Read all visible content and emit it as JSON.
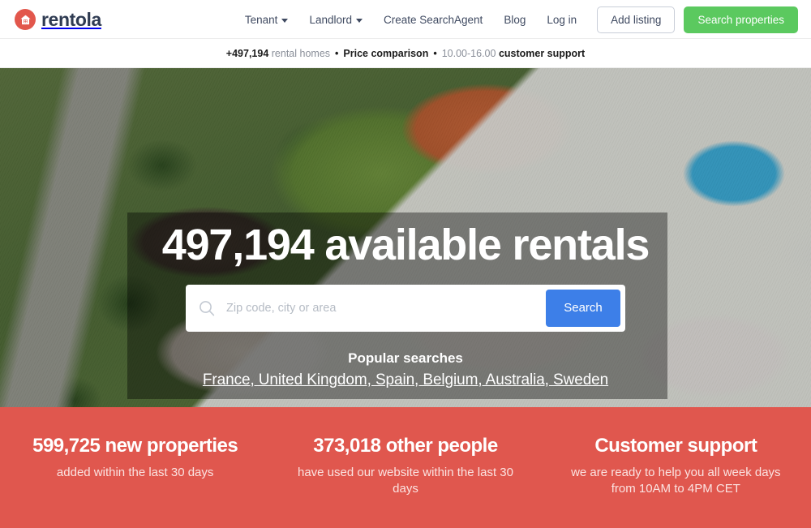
{
  "brand": {
    "name": "rentola",
    "logo_icon": "house-in-circle-icon",
    "color": "#e2574c"
  },
  "header": {
    "nav": [
      {
        "label": "Tenant",
        "has_caret": true,
        "name": "tenant"
      },
      {
        "label": "Landlord",
        "has_caret": true,
        "name": "landlord"
      },
      {
        "label": "Create SearchAgent",
        "has_caret": false,
        "name": "create-searchagent"
      },
      {
        "label": "Blog",
        "has_caret": false,
        "name": "blog"
      },
      {
        "label": "Log in",
        "has_caret": false,
        "name": "log-in"
      }
    ],
    "add_listing_label": "Add listing",
    "search_properties_label": "Search properties",
    "green_color": "#5bc95f"
  },
  "subheader": {
    "count": "+497,194",
    "count_suffix": "rental homes",
    "bullet": "•",
    "price_comparison": "Price comparison",
    "hours": "10.00-16.00",
    "support": "customer support"
  },
  "hero": {
    "title": "497,194 available rentals",
    "search_placeholder": "Zip code, city or area",
    "search_value": "",
    "search_button": "Search",
    "search_icon": "magnifier-icon",
    "search_button_color": "#3d7fe8",
    "popular_title": "Popular searches",
    "popular_links": "France, United Kingdom, Spain, Belgium, Australia, Sweden",
    "background_image": "aerial-photo-of-suburban-houses-with-pool"
  },
  "stats": {
    "background_color": "#e0574e",
    "items": [
      {
        "headline": "599,725 new properties",
        "subtext": "added within the last 30 days",
        "name": "new-properties"
      },
      {
        "headline": "373,018 other people",
        "subtext": "have used our website within the last 30 days",
        "name": "other-people"
      },
      {
        "headline": "Customer support",
        "subtext": "we are ready to help you all week days from 10AM to 4PM CET",
        "name": "customer-support"
      }
    ]
  }
}
